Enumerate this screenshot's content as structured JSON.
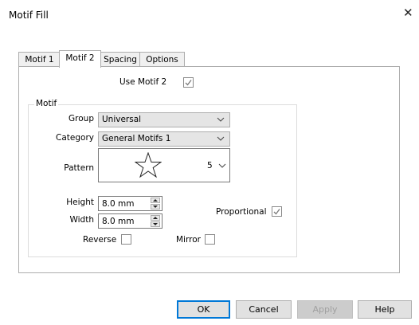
{
  "window": {
    "title": "Motif Fill"
  },
  "tabs": [
    {
      "label": "Motif 1"
    },
    {
      "label": "Motif 2"
    },
    {
      "label": "Spacing"
    },
    {
      "label": "Options"
    }
  ],
  "use_motif2": {
    "label": "Use Motif 2",
    "checked": true
  },
  "motif_group": {
    "legend": "Motif",
    "group": {
      "label": "Group",
      "value": "Universal"
    },
    "category": {
      "label": "Category",
      "value": "General Motifs 1"
    },
    "pattern": {
      "label": "Pattern",
      "value": "5",
      "preview_icon": "star-outline-icon"
    },
    "height": {
      "label": "Height",
      "value": "8.0 mm"
    },
    "width": {
      "label": "Width",
      "value": "8.0 mm"
    },
    "proportional": {
      "label": "Proportional",
      "checked": true
    },
    "reverse": {
      "label": "Reverse",
      "checked": false
    },
    "mirror": {
      "label": "Mirror",
      "checked": false
    }
  },
  "buttons": {
    "ok": "OK",
    "cancel": "Cancel",
    "apply": "Apply",
    "help": "Help"
  },
  "colors": {
    "accent": "#0078d7",
    "check": "#7a7a7a"
  }
}
